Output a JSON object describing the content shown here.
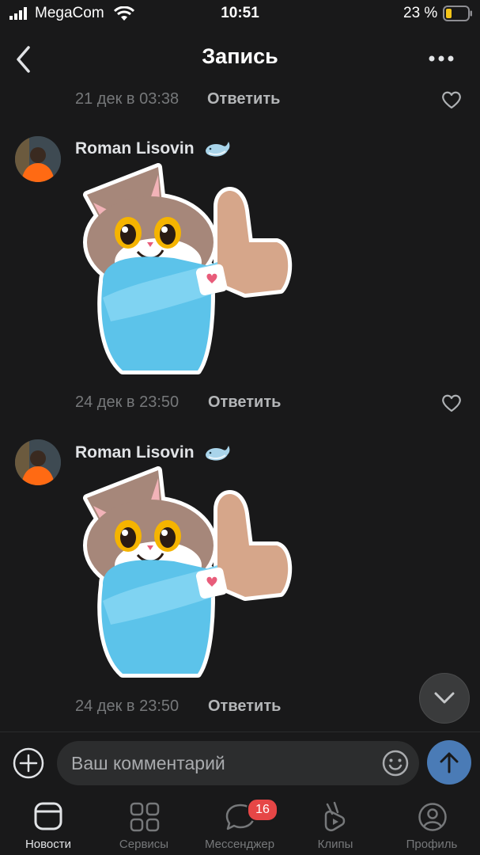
{
  "status_bar": {
    "carrier": "MegaCom",
    "time": "10:51",
    "battery_percent": "23 %"
  },
  "header": {
    "title": "Запись"
  },
  "comments": [
    {
      "date": "21 дек в 03:38",
      "reply_label": "Ответить"
    },
    {
      "author": "Roman Lisovin",
      "author_badge": "whale-emoji",
      "content": "cat-thumbs-up-sticker",
      "date": "24 дек в 23:50",
      "reply_label": "Ответить"
    },
    {
      "author": "Roman Lisovin",
      "author_badge": "whale-emoji",
      "content": "cat-thumbs-up-sticker",
      "date": "24 дек в 23:50",
      "reply_label": "Ответить"
    }
  ],
  "composer": {
    "placeholder": "Ваш комментарий"
  },
  "tabbar": {
    "items": [
      {
        "label": "Новости",
        "icon": "news-icon",
        "active": true
      },
      {
        "label": "Сервисы",
        "icon": "services-icon"
      },
      {
        "label": "Мессенджер",
        "icon": "messenger-icon",
        "badge": "16"
      },
      {
        "label": "Клипы",
        "icon": "clips-icon"
      },
      {
        "label": "Профиль",
        "icon": "profile-icon"
      }
    ]
  },
  "colors": {
    "background": "#19191a",
    "accent": "#4a7bb6",
    "badge": "#e64646"
  }
}
